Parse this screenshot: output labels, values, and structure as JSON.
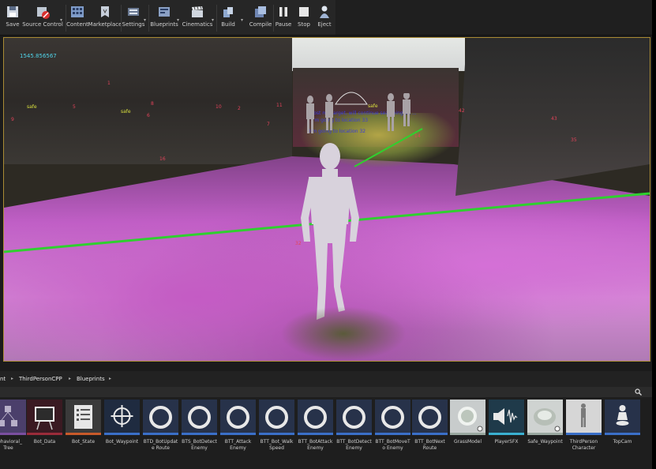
{
  "toolbar": {
    "buttons": [
      {
        "label": "Save",
        "icon": "save-icon"
      },
      {
        "label": "Source Control",
        "icon": "source-control-icon"
      },
      {
        "label": "Content",
        "icon": "content-icon"
      },
      {
        "label": "Marketplace",
        "icon": "marketplace-icon"
      },
      {
        "label": "Settings",
        "icon": "settings-icon"
      },
      {
        "label": "Blueprints",
        "icon": "blueprints-icon"
      },
      {
        "label": "Cinematics",
        "icon": "cinematics-icon"
      },
      {
        "label": "Build",
        "icon": "build-icon"
      },
      {
        "label": "Compile",
        "icon": "compile-icon"
      },
      {
        "label": "Pause",
        "icon": "pause-icon"
      },
      {
        "label": "Stop",
        "icon": "stop-icon"
      },
      {
        "label": "Eject",
        "icon": "eject-icon"
      }
    ]
  },
  "viewport": {
    "timer": "1545.856567",
    "safe_labels": [
      "safe",
      "safe",
      "safe"
    ],
    "debug_numbers": [
      "1",
      "5",
      "6",
      "8",
      "9",
      "10",
      "2",
      "11",
      "7",
      "16",
      "42",
      "43",
      "35",
      "14",
      "32"
    ],
    "messages": [
      "Lost my target, will continue searching on ...",
      "I'm going to location 33",
      "I'm going to location 32"
    ]
  },
  "content_browser": {
    "breadcrumb": [
      "nt",
      "ThirdPersonCPP",
      "Blueprints"
    ],
    "assets": [
      {
        "label": "Behavioral_ Tree",
        "kind": "tree",
        "color": "#7a4ea0"
      },
      {
        "label": "Bot_Data",
        "kind": "board",
        "color": "#9a2b3a"
      },
      {
        "label": "Bot_State",
        "kind": "doc",
        "color": "#c85a2a"
      },
      {
        "label": "Bot_Waypoint",
        "kind": "target",
        "color": "#3a6fc8"
      },
      {
        "label": "BTD_BotUpdate Route",
        "kind": "ring",
        "color": "#3a6fc8"
      },
      {
        "label": "BTS_BotDetect Enemy",
        "kind": "ring",
        "color": "#3a6fc8"
      },
      {
        "label": "BTT_Attack Enemy",
        "kind": "ring",
        "color": "#3a6fc8"
      },
      {
        "label": "BTT_Bot_Walk Speed",
        "kind": "ring",
        "color": "#3a6fc8"
      },
      {
        "label": "BTT_BotAttack Enemy",
        "kind": "ring",
        "color": "#3a6fc8"
      },
      {
        "label": "BTT_BotDetect Enemy",
        "kind": "ring",
        "color": "#3a6fc8"
      },
      {
        "label": "BTT_BotMoveTo Enemy",
        "kind": "ring",
        "color": "#3a6fc8"
      },
      {
        "label": "BTT_BotNext Route",
        "kind": "ring",
        "color": "#3a6fc8"
      },
      {
        "label": "GrassModel",
        "kind": "mesh",
        "color": "#9aa8a0"
      },
      {
        "label": "PlayerSFX",
        "kind": "sound",
        "color": "#3ab0d0"
      },
      {
        "label": "Safe_Waypoint",
        "kind": "mesh",
        "color": "#9aa8a0"
      },
      {
        "label": "ThirdPerson Character",
        "kind": "figure",
        "color": "#3a6fc8"
      },
      {
        "label": "TopCam",
        "kind": "pawn",
        "color": "#3a6fc8"
      }
    ]
  },
  "colors": {
    "viewport_border": "#a98b34",
    "debug_red": "#e2435a",
    "debug_yellow": "#d9e03e",
    "line_green": "#2fd02f"
  }
}
